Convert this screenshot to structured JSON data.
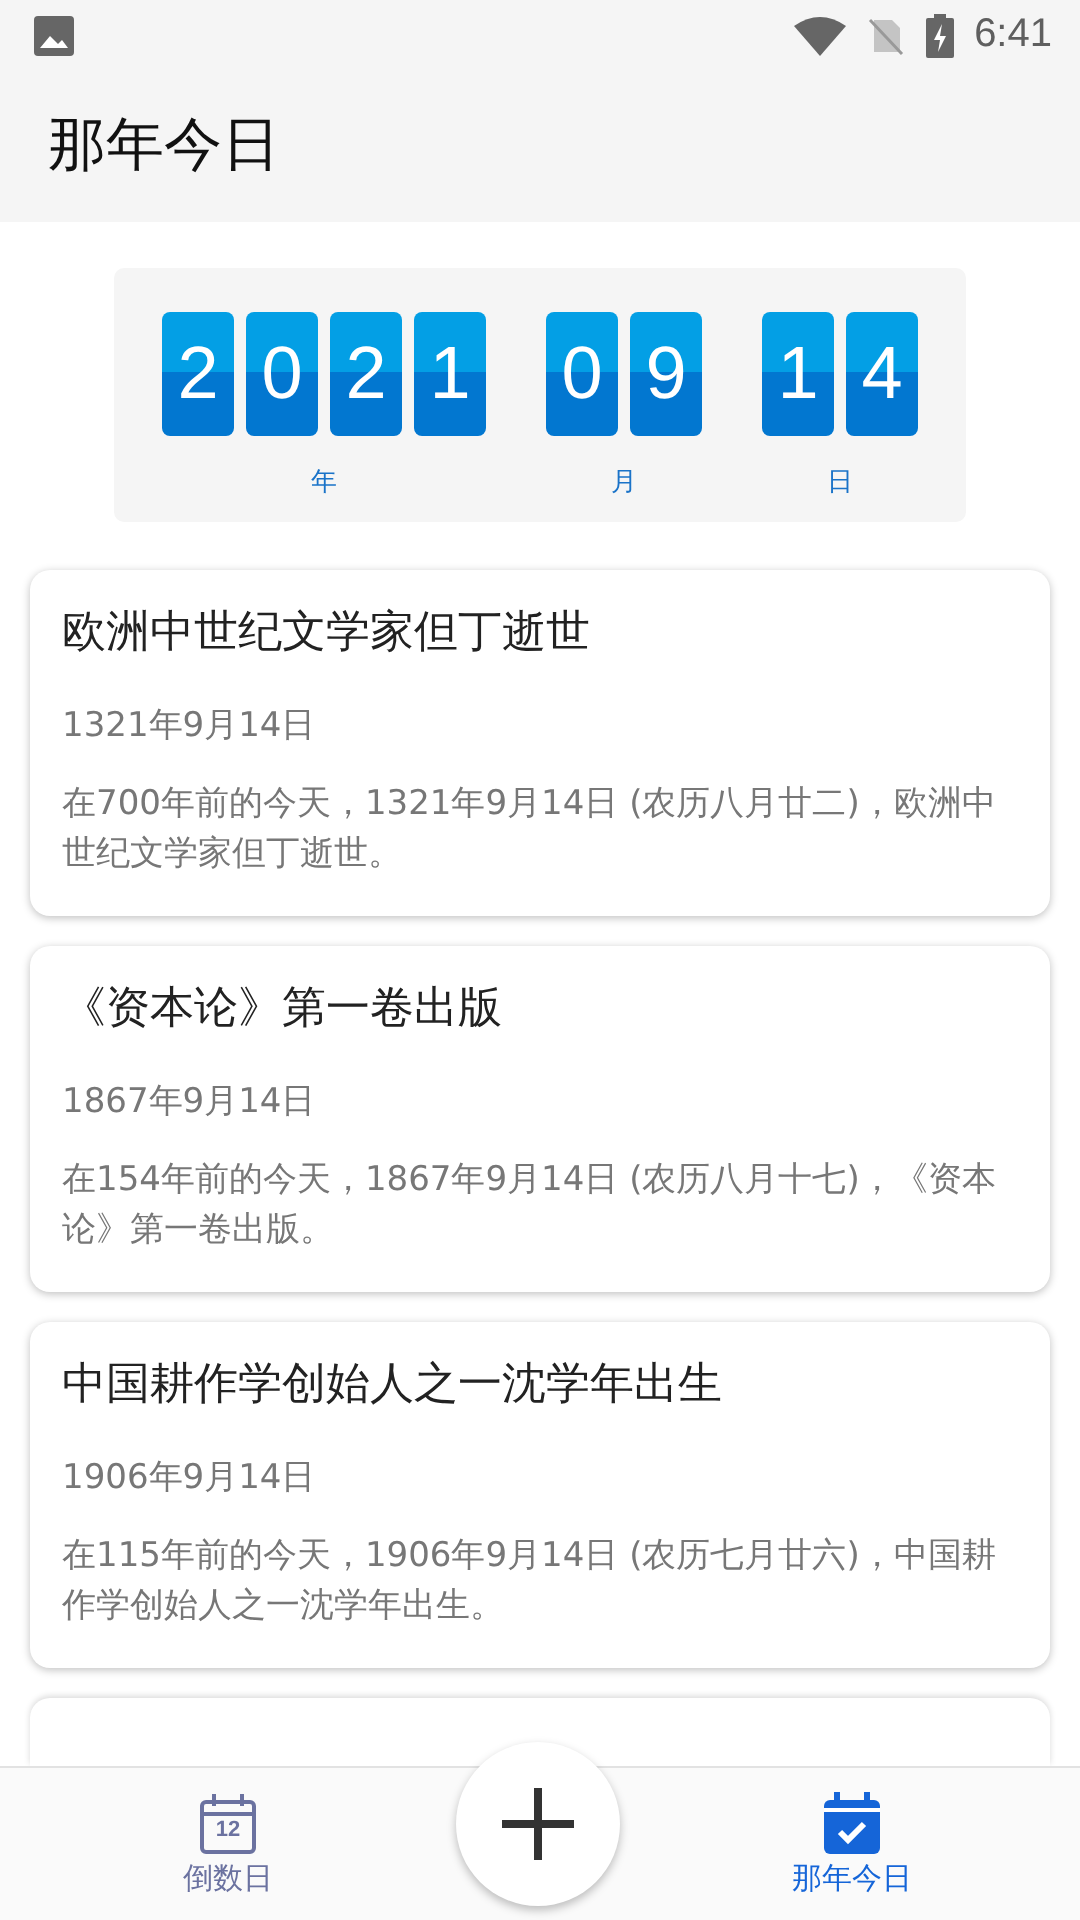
{
  "status_bar": {
    "time": "6:41"
  },
  "app_bar": {
    "title": "那年今日"
  },
  "date_panel": {
    "groups": [
      {
        "digits": [
          "2",
          "0",
          "2",
          "1"
        ],
        "label": "年"
      },
      {
        "digits": [
          "0",
          "9"
        ],
        "label": "月"
      },
      {
        "digits": [
          "1",
          "4"
        ],
        "label": "日"
      }
    ]
  },
  "events": [
    {
      "title": "欧洲中世纪文学家但丁逝世",
      "date": "1321年9月14日",
      "description": "在700年前的今天，1321年9月14日 (农历八月廿二)，欧洲中世纪文学家但丁逝世。"
    },
    {
      "title": "《资本论》第一卷出版",
      "date": "1867年9月14日",
      "description": "在154年前的今天，1867年9月14日 (农历八月十七)，《资本论》第一卷出版。"
    },
    {
      "title": "中国耕作学创始人之一沈学年出生",
      "date": "1906年9月14日",
      "description": "在115年前的今天，1906年9月14日 (农历七月廿六)，中国耕作学创始人之一沈学年出生。"
    }
  ],
  "bottom_nav": {
    "items": [
      {
        "label": "倒数日",
        "icon_text": "12",
        "selected": false
      },
      {
        "label": "那年今日",
        "selected": true
      }
    ]
  }
}
